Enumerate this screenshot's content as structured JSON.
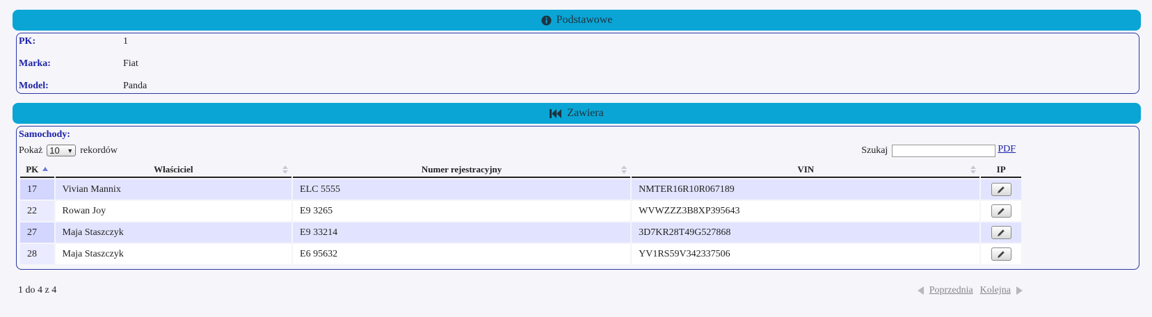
{
  "basic_section": {
    "title": "Podstawowe",
    "icon": "info-circle-icon",
    "fields": [
      {
        "label": "PK:",
        "value": "1"
      },
      {
        "label": "Marka:",
        "value": "Fiat"
      },
      {
        "label": "Model:",
        "value": "Panda"
      }
    ]
  },
  "contains_section": {
    "title": "Zawiera",
    "icon": "fast-backward-icon",
    "subtitle": "Samochody:",
    "show_prefix": "Pokaż",
    "show_value": "10",
    "show_suffix": "rekordów",
    "search_label": "Szukaj",
    "search_value": "",
    "pdf_label": "PDF",
    "columns": [
      "PK",
      "Właściciel",
      "Numer rejestracyjny",
      "VIN",
      "IP"
    ],
    "rows": [
      {
        "pk": "17",
        "owner": "Vivian Mannix",
        "reg": "ELC 5555",
        "vin": "NMTER16R10R067189"
      },
      {
        "pk": "22",
        "owner": "Rowan Joy",
        "reg": "E9 3265",
        "vin": "WVWZZZ3B8XP395643"
      },
      {
        "pk": "27",
        "owner": "Maja Staszczyk",
        "reg": "E9 33214",
        "vin": "3D7KR28T49G527868"
      },
      {
        "pk": "28",
        "owner": "Maja Staszczyk",
        "reg": "E6 95632",
        "vin": "YV1RS59V342337506"
      }
    ],
    "info": "1 do 4 z 4",
    "prev_label": "Poprzednia",
    "next_label": "Kolejna"
  }
}
